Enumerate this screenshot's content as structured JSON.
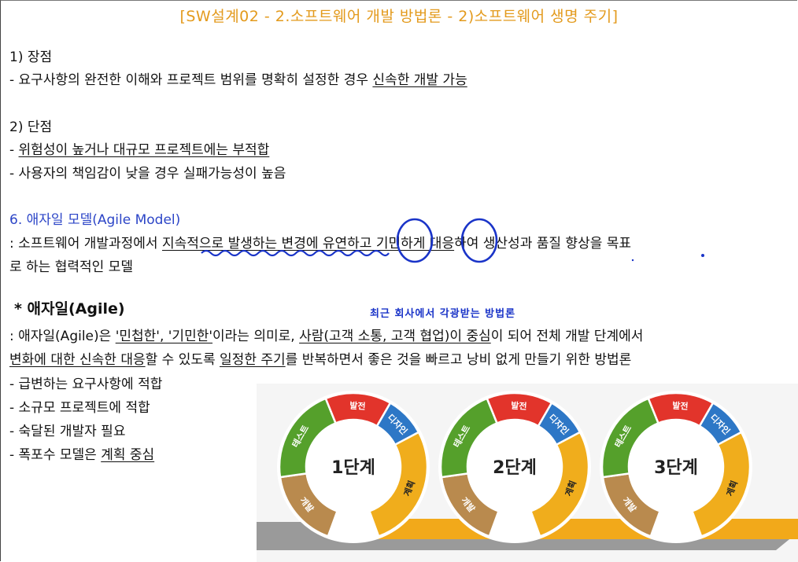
{
  "title": "[SW설계02 - 2.소프트웨어 개발 방법론 - 2)소프트웨어 생명 주기]",
  "pros": {
    "heading": "1) 장점",
    "item1_prefix": "- 요구사항의 완전한 이해와 프로젝트 범위를 명확히 설정한 경우 ",
    "item1_underlined": "신속한 개발 가능"
  },
  "cons": {
    "heading": "2) 단점",
    "item1_dash": "- ",
    "item1_underlined": "위험성이 높거나 대규모 프로젝트에는 부적합",
    "item2": "- 사용자의 책임감이 낮을 경우 실패가능성이 높음"
  },
  "agile_model": {
    "heading": "6. 애자일 모델(Agile Model)",
    "def_prefix": ": 소프트웨어 개발과정에서 ",
    "def_underlined": "지속적으로 발생하는 변경에 유연하고 기민하게 대응",
    "def_suffix": "하여 생산성과 품질 향상을 목표",
    "def_line2": "로 하는 협력적인 모델"
  },
  "agile": {
    "heading": "* 애자일(Agile)",
    "note": "최근 회사에서 각광받는 방법론",
    "l1_a": ": 애자일(Agile)은 ",
    "l1_b": "'민첩한', '기민한'",
    "l1_c": "이라는 의미로, ",
    "l1_d": "사람(고객 소통, 고객 협업)이 중심",
    "l1_e": "이 되어 전체 개발 단계에서",
    "l2_a": "변화에 대한 신속한 대응",
    "l2_b": "할 수 있도록 ",
    "l2_c": "일정한 주기",
    "l2_d": "를 반복하면서 좋은 것을 빠르고 낭비 없게 만들기 위한 방법론",
    "bullet1": "- 급변하는 요구사항에 적합",
    "bullet2": "- 소규모 프로젝트에 적합",
    "bullet3": "- 숙달된 개발자 필요",
    "bullet4_prefix": "- 폭포수 모델은 ",
    "bullet4_underlined": "계획 중심"
  },
  "diagram": {
    "segments": {
      "test": "테스트",
      "deploy": "발전",
      "design": "디자인",
      "plan": "계획",
      "build": "개발"
    },
    "stages": [
      "1단계",
      "2단계",
      "3단계"
    ],
    "colors": {
      "green": "#55a02b",
      "red": "#e2342b",
      "blue": "#2d77c6",
      "yellow": "#f0ad1c",
      "brown": "#b98a4e",
      "arrow": "#9a9a9a",
      "track": "#f2a91a"
    }
  }
}
